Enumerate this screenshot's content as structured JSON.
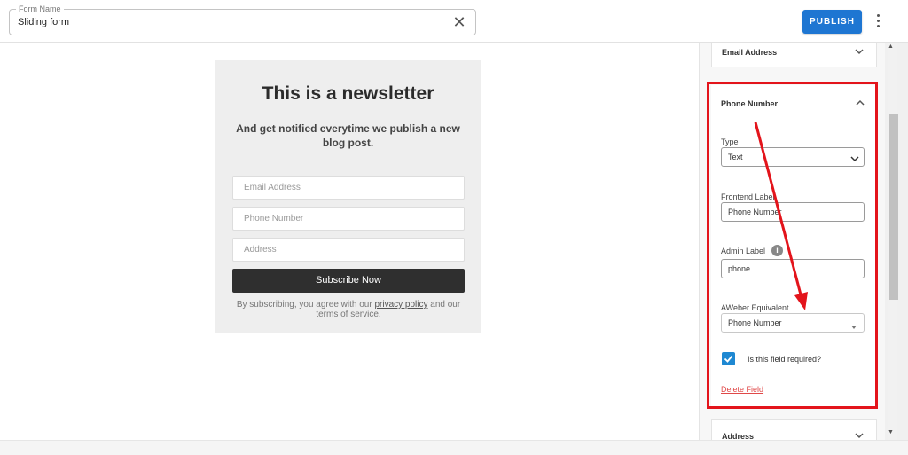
{
  "header": {
    "form_name_label": "Form Name",
    "form_name_value": "Sliding form",
    "publish_label": "PUBLISH"
  },
  "preview": {
    "title": "This is a newsletter",
    "subtitle": "And get notified everytime we publish a new blog post.",
    "inputs": [
      {
        "placeholder": "Email Address"
      },
      {
        "placeholder": "Phone Number"
      },
      {
        "placeholder": "Address"
      }
    ],
    "button_label": "Subscribe Now",
    "terms_prefix": "By subscribing, you agree with our",
    "terms_link": "privacy policy",
    "terms_suffix": "and our terms of service."
  },
  "sidebar": {
    "email_card_title": "Email Address",
    "phone_card": {
      "title": "Phone Number",
      "type_label": "Type",
      "type_value": "Text",
      "frontend_label_label": "Frontend Label",
      "frontend_label_value": "Phone Number",
      "admin_label_label": "Admin Label",
      "admin_label_value": "phone",
      "aweber_label": "AWeber Equivalent",
      "aweber_value": "Phone Number",
      "required_label": "Is this field required?",
      "required_checked": true,
      "delete_label": "Delete Field"
    },
    "address_card_title": "Address"
  },
  "colors": {
    "accent": "#1e76d2",
    "highlight": "#e3141b",
    "danger": "#e04848"
  }
}
